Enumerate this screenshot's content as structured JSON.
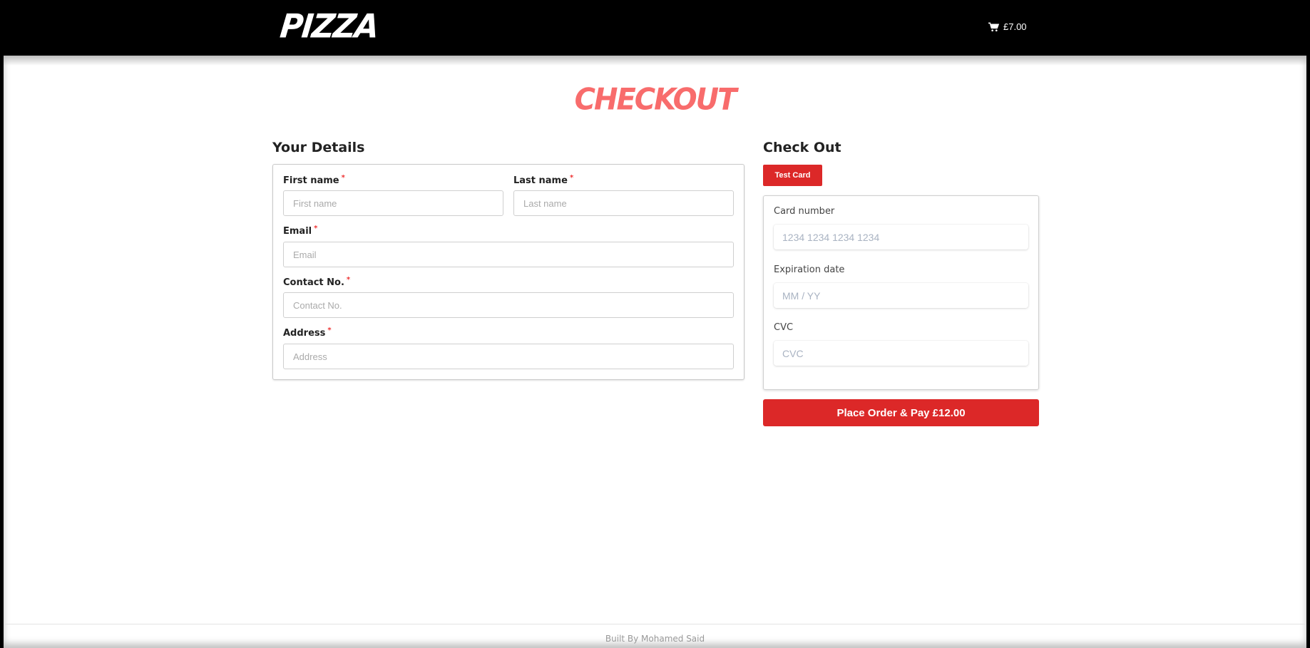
{
  "header": {
    "logo": "PIZZA",
    "cart_total": "£7.00",
    "cart_icon": "shopping-cart-icon"
  },
  "page_title": "CHECKOUT",
  "details": {
    "heading": "Your Details",
    "required_marker": "*",
    "first_name": {
      "label": "First name",
      "placeholder": "First name",
      "value": ""
    },
    "last_name": {
      "label": "Last name",
      "placeholder": "Last name",
      "value": ""
    },
    "email": {
      "label": "Email",
      "placeholder": "Email",
      "value": ""
    },
    "contact": {
      "label": "Contact No.",
      "placeholder": "Contact No.",
      "value": ""
    },
    "address": {
      "label": "Address",
      "placeholder": "Address",
      "value": ""
    }
  },
  "checkout": {
    "heading": "Check Out",
    "test_card_label": "Test Card",
    "card_number": {
      "label": "Card number",
      "placeholder": "1234 1234 1234 1234"
    },
    "expiration": {
      "label": "Expiration date",
      "placeholder": "MM / YY"
    },
    "cvc": {
      "label": "CVC",
      "placeholder": "CVC"
    },
    "pay_label": "Place Order & Pay £12.00"
  },
  "footer": {
    "text": "Built By Mohamed Said"
  },
  "colors": {
    "accent": "#dc2828",
    "title": "#f86c6c",
    "header_bg": "#000000"
  }
}
